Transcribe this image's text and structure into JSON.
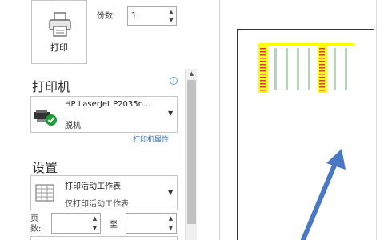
{
  "print": {
    "button_label": "打印"
  },
  "copies": {
    "label": "份数:",
    "value": "1"
  },
  "printer": {
    "heading": "打印机",
    "name": "HP LaserJet P2035n...",
    "status": "脱机",
    "properties_link": "打印机属性"
  },
  "settings": {
    "heading": "设置",
    "scope_title": "打印活动工作表",
    "scope_desc": "仅打印活动工作表",
    "pages_label": "页数:",
    "to_label": "至"
  },
  "icons": {
    "print": "printer-icon",
    "info": "info-icon",
    "printer_device": "printer-offline-icon",
    "scope": "sheet-grid-icon",
    "caret": "chevron-down-icon"
  },
  "colors": {
    "accent": "#2e6fb7",
    "highlight": "#ffff00",
    "arrow": "#4a78c2",
    "offline_check": "#1e9c3a"
  }
}
